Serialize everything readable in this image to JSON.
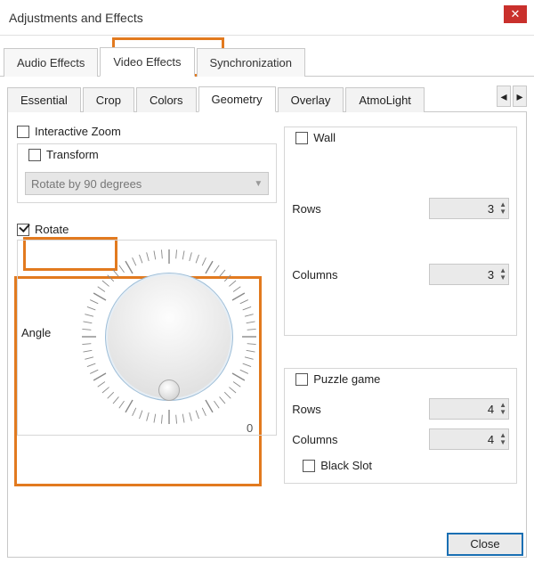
{
  "window": {
    "title": "Adjustments and Effects"
  },
  "top_tabs": {
    "audio": "Audio Effects",
    "video": "Video Effects",
    "sync": "Synchronization",
    "active": "video"
  },
  "sub_tabs": {
    "items": [
      "Essential",
      "Crop",
      "Colors",
      "Geometry",
      "Overlay",
      "AtmoLight"
    ],
    "active_index": 3
  },
  "left": {
    "interactive_zoom": "Interactive Zoom",
    "transform_label": "Transform",
    "transform_value": "Rotate by 90 degrees",
    "rotate_label": "Rotate",
    "angle_label": "Angle",
    "angle_zero": "0"
  },
  "right": {
    "wall": {
      "label": "Wall",
      "rows_label": "Rows",
      "rows_value": "3",
      "cols_label": "Columns",
      "cols_value": "3"
    },
    "puzzle": {
      "label": "Puzzle game",
      "rows_label": "Rows",
      "rows_value": "4",
      "cols_label": "Columns",
      "cols_value": "4",
      "blackslot_label": "Black Slot"
    }
  },
  "footer": {
    "close": "Close"
  },
  "colors": {
    "accent": "#e27a1f",
    "danger": "#c9302c",
    "primary": "#1a6fb3"
  }
}
